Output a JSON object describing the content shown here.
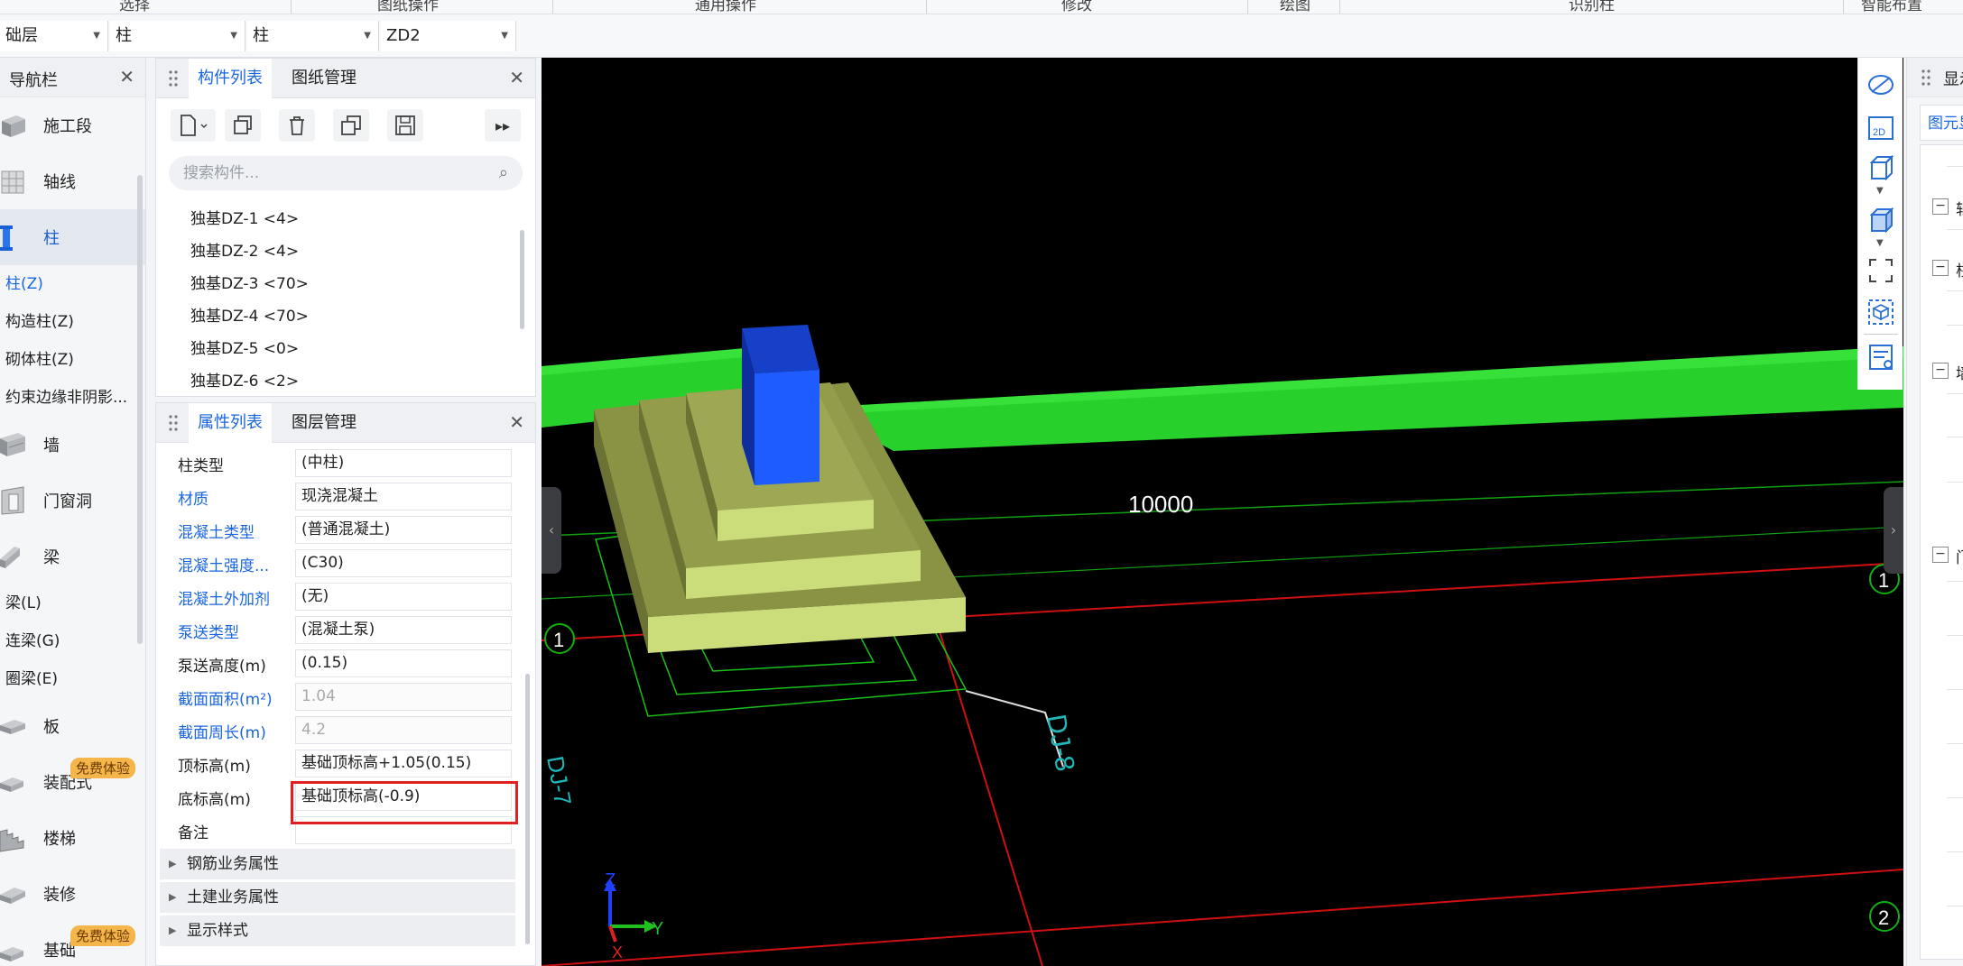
{
  "ribbon": {
    "groups": [
      "选择",
      "图纸操作",
      "通用操作",
      "修改",
      "绘图",
      "识别柱",
      "智能布置"
    ]
  },
  "selectors": {
    "floor": "础层",
    "category": "柱",
    "type": "柱",
    "component": "ZD2"
  },
  "nav": {
    "title": "导航栏",
    "categories": [
      {
        "label": "施工段",
        "icon": "segment-icon"
      },
      {
        "label": "轴线",
        "icon": "axis-grid-icon"
      },
      {
        "label": "柱",
        "icon": "column-icon"
      }
    ],
    "column_subs": [
      "柱(Z)",
      "构造柱(Z)",
      "砌体柱(Z)",
      "约束边缘非阴影..."
    ],
    "categories2": [
      {
        "label": "墙",
        "icon": "wall-icon"
      },
      {
        "label": "门窗洞",
        "icon": "door-window-icon"
      },
      {
        "label": "梁",
        "icon": "beam-icon"
      }
    ],
    "beam_subs": [
      "梁(L)",
      "连梁(G)",
      "圈梁(E)"
    ],
    "categories3": [
      {
        "label": "板",
        "icon": "slab-icon"
      },
      {
        "label": "装配式",
        "icon": "prefab-icon",
        "badge": "免费体验"
      },
      {
        "label": "楼梯",
        "icon": "stair-icon"
      },
      {
        "label": "装修",
        "icon": "decoration-icon"
      },
      {
        "label": "基础",
        "icon": "foundation-icon",
        "badge": "免费体验"
      }
    ]
  },
  "component_panel": {
    "tabs": [
      "构件列表",
      "图纸管理"
    ],
    "search_placeholder": "搜索构件...",
    "items": [
      "独基DZ-1 <4>",
      "独基DZ-2 <4>",
      "独基DZ-3 <70>",
      "独基DZ-4 <70>",
      "独基DZ-5 <0>",
      "独基DZ-6 <2>"
    ]
  },
  "property_panel": {
    "tabs": [
      "属性列表",
      "图层管理"
    ],
    "rows": [
      {
        "name": "柱类型",
        "value": "(中柱)",
        "blue": false,
        "readonly": false
      },
      {
        "name": "材质",
        "value": "现浇混凝土",
        "blue": true,
        "readonly": false
      },
      {
        "name": "混凝土类型",
        "value": "(普通混凝土)",
        "blue": true,
        "readonly": false
      },
      {
        "name": "混凝土强度...",
        "value": "(C30)",
        "blue": true,
        "readonly": false
      },
      {
        "name": "混凝土外加剂",
        "value": "(无)",
        "blue": true,
        "readonly": false
      },
      {
        "name": "泵送类型",
        "value": "(混凝土泵)",
        "blue": true,
        "readonly": false
      },
      {
        "name": "泵送高度(m)",
        "value": "(0.15)",
        "blue": false,
        "readonly": false
      },
      {
        "name": "截面面积(m²)",
        "value": "1.04",
        "blue": true,
        "readonly": true
      },
      {
        "name": "截面周长(m)",
        "value": "4.2",
        "blue": true,
        "readonly": true
      },
      {
        "name": "顶标高(m)",
        "value": "基础顶标高+1.05(0.15)",
        "blue": false,
        "readonly": false
      },
      {
        "name": "底标高(m)",
        "value": "基础顶标高(-0.9)",
        "blue": false,
        "readonly": false
      },
      {
        "name": "备注",
        "value": "",
        "blue": false,
        "readonly": false
      }
    ],
    "groups": [
      "钢筋业务属性",
      "土建业务属性",
      "显示样式"
    ]
  },
  "viewport": {
    "dimension_label": "10000",
    "axis_markers": [
      "1",
      "1",
      "2"
    ],
    "axis_labels": {
      "z": "Z",
      "y": "Y",
      "x": "X"
    },
    "annotation": "DJ-8",
    "annotation2": "DJ-7"
  },
  "view_tools": [
    "orbit-icon",
    "2d-view-icon",
    "cube-view-icon",
    "shaded-cube-icon",
    "fit-view-icon",
    "select-box-icon",
    "display-settings-icon"
  ],
  "right_panel": {
    "title": "显示设置",
    "tab": "图元显示",
    "groups": [
      "轴",
      "柱",
      "墙",
      "门"
    ]
  },
  "colors": {
    "accent": "#1a66e0",
    "highlight_border": "#e02020",
    "beam_green": "#27d02a",
    "column_blue": "#1f5cff",
    "footing": "#9aa552"
  }
}
